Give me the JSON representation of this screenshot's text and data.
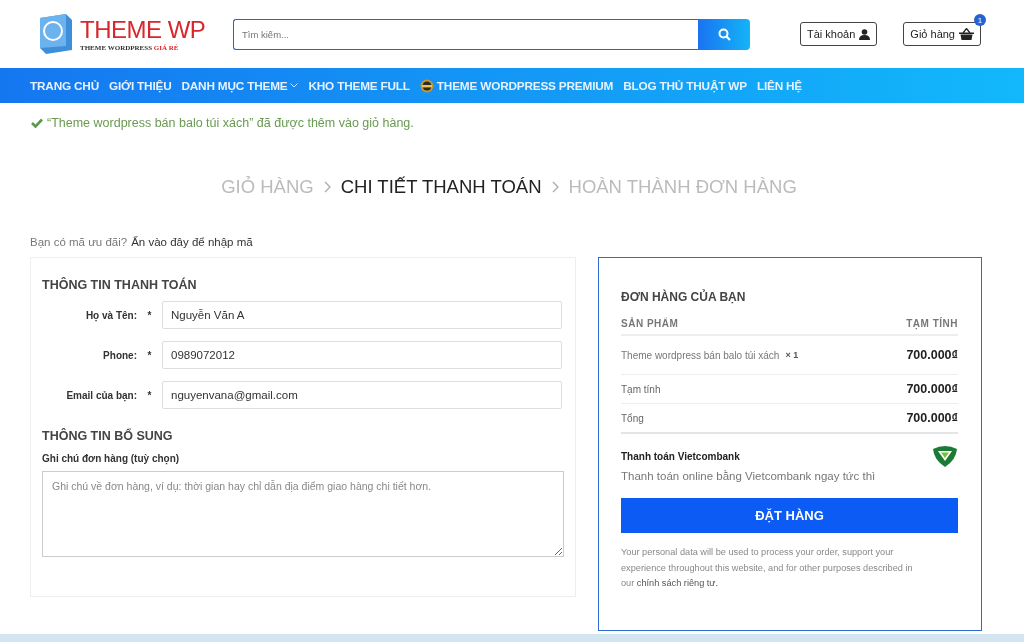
{
  "header": {
    "logo": {
      "title": "THEME WP",
      "tagline_main": "THEME WORDPRESS",
      "tagline_accent": "GIÁ RẺ"
    },
    "search": {
      "placeholder": "Tìm kiếm..."
    },
    "account": {
      "label": "Tài khoản"
    },
    "cart": {
      "label": "Giỏ hàng",
      "count": "1"
    }
  },
  "nav": [
    {
      "label": "TRANG CHỦ",
      "kind": "plain"
    },
    {
      "label": "GIỚI THIỆU",
      "kind": "plain"
    },
    {
      "label": "DANH MỤC THEME",
      "kind": "dropdown"
    },
    {
      "label": "KHO THEME FULL",
      "kind": "plain"
    },
    {
      "label": "THEME WORDPRESS PREMIUM",
      "kind": "badge"
    },
    {
      "label": "BLOG THỦ THUẬT WP",
      "kind": "plain"
    },
    {
      "label": "LIÊN HỆ",
      "kind": "plain"
    }
  ],
  "notice": "“Theme wordpress bán balo túi xách” đã được thêm vào giỏ hàng.",
  "steps": [
    {
      "label": "GIỎ HÀNG",
      "selected": false
    },
    {
      "label": "CHI TIẾT THANH TOÁN",
      "selected": true
    },
    {
      "label": "HOÀN THÀNH ĐƠN HÀNG",
      "selected": false
    }
  ],
  "coupon": {
    "question": "Bạn có mã ưu đãi?",
    "link": "Ấn vào đây để nhập mã"
  },
  "billing": {
    "title": "THÔNG TIN THANH TOÁN",
    "fields": [
      {
        "label": "Họ và Tên:",
        "required_mark": "*",
        "value": "Nguyễn Văn A"
      },
      {
        "label": "Phone:",
        "required_mark": "*",
        "value": "0989072012"
      },
      {
        "label": "Email của bạn:",
        "required_mark": "*",
        "value": "nguyenvana@gmail.com"
      }
    ]
  },
  "additional": {
    "title": "THÔNG TIN BỔ SUNG",
    "notes_label": "Ghi chú đơn hàng (tuỳ chọn)",
    "notes_placeholder": "Ghi chú về đơn hàng, ví dụ: thời gian hay chỉ dẫn địa điểm giao hàng chi tiết hơn."
  },
  "order": {
    "title": "ĐƠN HÀNG CỦA BẠN",
    "columns": [
      "SẢN PHẨM",
      "TẠM TÍNH"
    ],
    "items": [
      {
        "name": "Theme wordpress bán balo túi xách",
        "qty": "× 1",
        "price": "700.000₫"
      }
    ],
    "subtotal": {
      "label": "Tạm tính",
      "value": "700.000₫"
    },
    "total": {
      "label": "Tổng",
      "value": "700.000₫"
    },
    "payment": {
      "name": "Thanh toán Vietcombank",
      "description": "Thanh toán online bằng Vietcombank ngay tức thì"
    },
    "button": "ĐẶT HÀNG",
    "privacy_text": "Your personal data will be used to process your order, support your experience throughout this website, and for other purposes described in our",
    "privacy_link": "chính sách riêng tư."
  }
}
